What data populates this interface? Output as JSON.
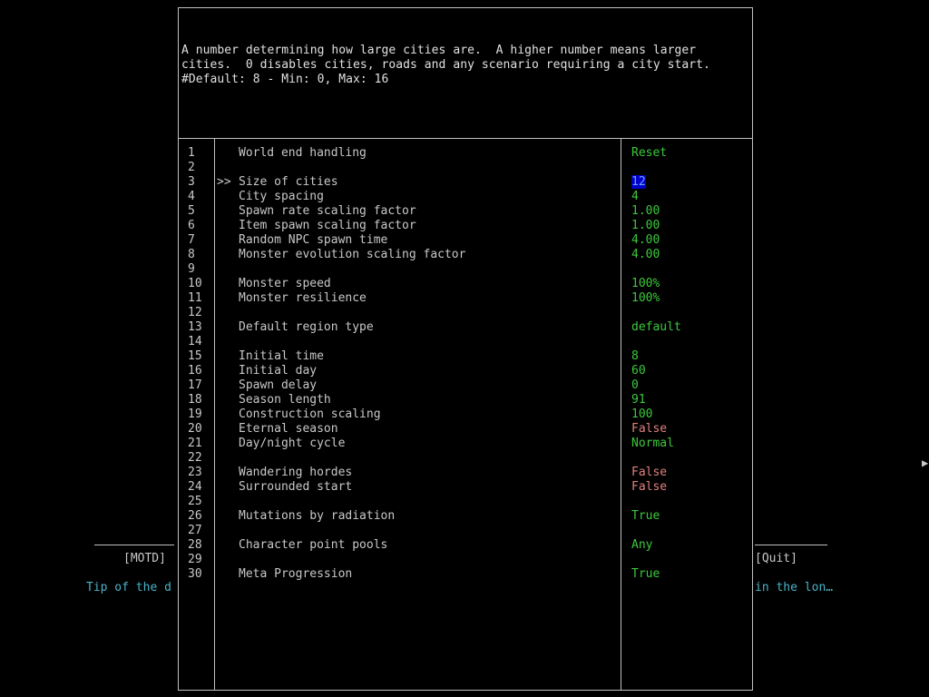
{
  "background": {
    "motd_label": "[MOTD]",
    "quit_label": "[Quit]",
    "tip_left": "Tip of the d",
    "tip_right": "in the lon…",
    "cursor_glyph": "▶"
  },
  "description": {
    "lines": [
      "A number determining how large cities are.  A higher number means larger",
      "cities.  0 disables cities, roads and any scenario requiring a city start.",
      "#Default: 8 - Min: 0, Max: 16"
    ]
  },
  "selector": ">>",
  "options": [
    {
      "num": "1",
      "label": "World end handling",
      "value": "Reset",
      "style": "green"
    },
    {
      "num": "2",
      "label": "",
      "value": "",
      "style": "green"
    },
    {
      "num": "3",
      "label": "Size of cities",
      "value": "12",
      "style": "selected",
      "selected": true
    },
    {
      "num": "4",
      "label": "City spacing",
      "value": "4",
      "style": "green"
    },
    {
      "num": "5",
      "label": "Spawn rate scaling factor",
      "value": "1.00",
      "style": "green"
    },
    {
      "num": "6",
      "label": "Item spawn scaling factor",
      "value": "1.00",
      "style": "green"
    },
    {
      "num": "7",
      "label": "Random NPC spawn time",
      "value": "4.00",
      "style": "green"
    },
    {
      "num": "8",
      "label": "Monster evolution scaling factor",
      "value": "4.00",
      "style": "green"
    },
    {
      "num": "9",
      "label": "",
      "value": "",
      "style": "green"
    },
    {
      "num": "10",
      "label": "Monster speed",
      "value": "100%",
      "style": "green"
    },
    {
      "num": "11",
      "label": "Monster resilience",
      "value": "100%",
      "style": "green"
    },
    {
      "num": "12",
      "label": "",
      "value": "",
      "style": "green"
    },
    {
      "num": "13",
      "label": "Default region type",
      "value": "default",
      "style": "green"
    },
    {
      "num": "14",
      "label": "",
      "value": "",
      "style": "green"
    },
    {
      "num": "15",
      "label": "Initial time",
      "value": "8",
      "style": "green"
    },
    {
      "num": "16",
      "label": "Initial day",
      "value": "60",
      "style": "green"
    },
    {
      "num": "17",
      "label": "Spawn delay",
      "value": "0",
      "style": "green"
    },
    {
      "num": "18",
      "label": "Season length",
      "value": "91",
      "style": "green"
    },
    {
      "num": "19",
      "label": "Construction scaling",
      "value": "100",
      "style": "green"
    },
    {
      "num": "20",
      "label": "Eternal season",
      "value": "False",
      "style": "red"
    },
    {
      "num": "21",
      "label": "Day/night cycle",
      "value": "Normal",
      "style": "green"
    },
    {
      "num": "22",
      "label": "",
      "value": "",
      "style": "green"
    },
    {
      "num": "23",
      "label": "Wandering hordes",
      "value": "False",
      "style": "red"
    },
    {
      "num": "24",
      "label": "Surrounded start",
      "value": "False",
      "style": "red"
    },
    {
      "num": "25",
      "label": "",
      "value": "",
      "style": "green"
    },
    {
      "num": "26",
      "label": "Mutations by radiation",
      "value": "True",
      "style": "green"
    },
    {
      "num": "27",
      "label": "",
      "value": "",
      "style": "green"
    },
    {
      "num": "28",
      "label": "Character point pools",
      "value": "Any",
      "style": "green"
    },
    {
      "num": "29",
      "label": "",
      "value": "",
      "style": "green"
    },
    {
      "num": "30",
      "label": "Meta Progression",
      "value": "True",
      "style": "green"
    }
  ],
  "colors": {
    "background": "#000000",
    "border": "#c0c0c0",
    "text": "#c8c8c8",
    "value_green": "#3cc83c",
    "value_red": "#e08080",
    "selection_bg": "#0000c8",
    "tip_cyan": "#4ab4c8"
  }
}
